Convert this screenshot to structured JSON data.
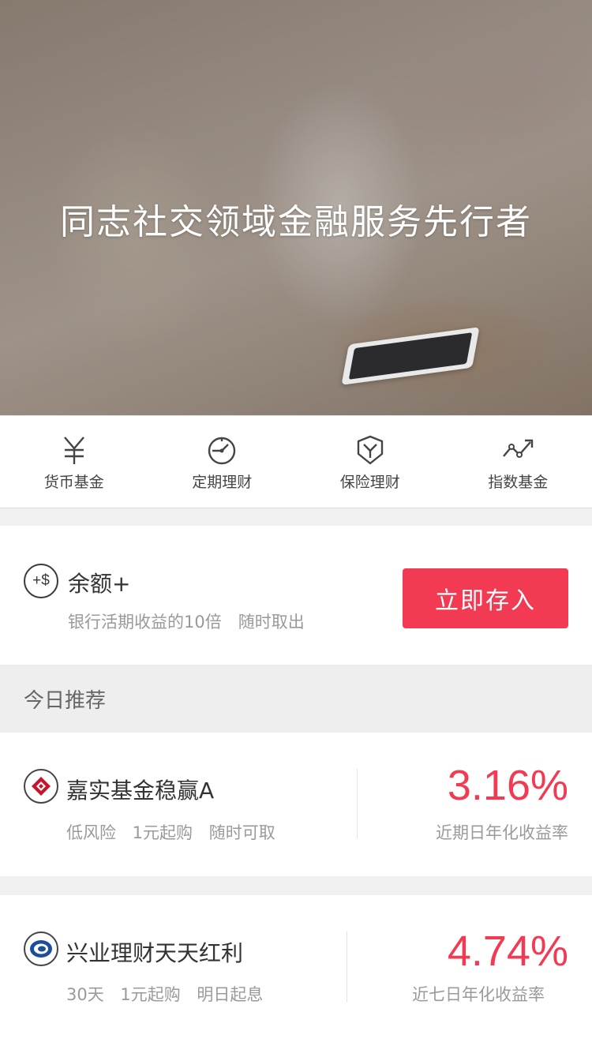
{
  "hero": {
    "title": "同志社交领域金融服务先行者"
  },
  "categories": [
    {
      "label": "货币基金",
      "icon": "yen-icon"
    },
    {
      "label": "定期理财",
      "icon": "clock-icon"
    },
    {
      "label": "保险理财",
      "icon": "shield-icon"
    },
    {
      "label": "指数基金",
      "icon": "trend-chart-icon"
    }
  ],
  "balance_plus": {
    "icon_text": "+$",
    "title": "余额+",
    "subtitle": "银行活期收益的10倍　随时取出",
    "button_label": "立即存入"
  },
  "recommend": {
    "title": "今日推荐",
    "products": [
      {
        "name": "嘉实基金稳赢A",
        "tags": "低风险 1元起购 随时可取",
        "rate": "3.16%",
        "rate_label": "近期日年化收益率"
      },
      {
        "name": "兴业理财天天红利",
        "tags": "30天 1元起购 明日起息",
        "rate": "4.74%",
        "rate_label": "近七日年化收益率"
      }
    ]
  },
  "colors": {
    "accent": "#f23a53",
    "text_primary": "#333333",
    "text_secondary": "#999999",
    "divider": "#f0f0f0"
  }
}
